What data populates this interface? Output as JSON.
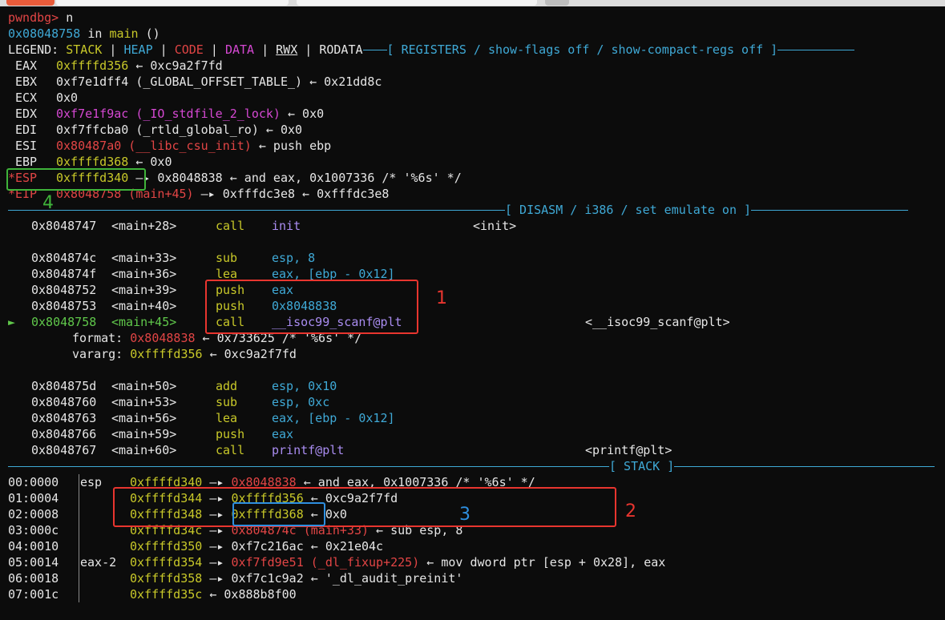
{
  "prompt": "pwndbg>",
  "command": "n",
  "location": {
    "addr": "0x08048758",
    "in": "in",
    "func": "main",
    "args": "()"
  },
  "legend": {
    "label": "LEGEND:",
    "stack": "STACK",
    "heap": "HEAP",
    "code": "CODE",
    "data": "DATA",
    "rwx": "RWX",
    "rodata": "RODATA"
  },
  "headers": {
    "registers": "[ REGISTERS / show-flags off / show-compact-regs off ]",
    "disasm": "[ DISASM / i386 / set emulate on ]",
    "stack": "[ STACK ]"
  },
  "registers": [
    {
      "name": "EAX",
      "star": "",
      "val": "0xffffd356",
      "rest": " ← 0xc9a2f7fd"
    },
    {
      "name": "EBX",
      "star": "",
      "val": "0xf7e1dff4 (_GLOBAL_OFFSET_TABLE_)",
      "rest": " ← 0x21dd8c"
    },
    {
      "name": "ECX",
      "star": "",
      "val": "0x0",
      "rest": ""
    },
    {
      "name": "EDX",
      "star": "",
      "val": "0xf7e1f9ac (_IO_stdfile_2_lock)",
      "rest": " ← 0x0"
    },
    {
      "name": "EDI",
      "star": "",
      "val": "0xf7ffcba0 (_rtld_global_ro)",
      "rest": " ← 0x0"
    },
    {
      "name": "ESI",
      "star": "",
      "val": "0x80487a0 (__libc_csu_init)",
      "rest": " ← push ebp"
    },
    {
      "name": "EBP",
      "star": "",
      "val": "0xffffd368",
      "rest": " ← 0x0"
    },
    {
      "name": "ESP",
      "star": "*",
      "val": "0xffffd340",
      "rest": " —▸ 0x8048838 ← and eax, 0x1007336 /* '%6s' */"
    },
    {
      "name": "EIP",
      "star": "*",
      "val": "0x8048758 (main+45)",
      "rest": " —▸ 0xfffdc3e8 ← 0xfffdc3e8"
    }
  ],
  "disasm": [
    {
      "marker": "",
      "addr": "0x8048747",
      "sym": "<main+28>",
      "op": "call",
      "args": "init",
      "target": "<init>"
    },
    {
      "marker": "",
      "addr": "",
      "sym": "",
      "op": "",
      "args": "",
      "target": ""
    },
    {
      "marker": "",
      "addr": "0x804874c",
      "sym": "<main+33>",
      "op": "sub",
      "args": "esp, 8",
      "target": ""
    },
    {
      "marker": "",
      "addr": "0x804874f",
      "sym": "<main+36>",
      "op": "lea",
      "args": "eax, [ebp - 0x12]",
      "target": ""
    },
    {
      "marker": "",
      "addr": "0x8048752",
      "sym": "<main+39>",
      "op": "push",
      "args": "eax",
      "target": ""
    },
    {
      "marker": "",
      "addr": "0x8048753",
      "sym": "<main+40>",
      "op": "push",
      "args": "0x8048838",
      "target": ""
    },
    {
      "marker": "►",
      "addr": "0x8048758",
      "sym": "<main+45>",
      "op": "call",
      "args": "__isoc99_scanf@plt",
      "target": "<__isoc99_scanf@plt>"
    }
  ],
  "call_args": [
    {
      "label": "format:",
      "val": "0x8048838",
      "rest": " ← 0x733625 /* '%6s' */"
    },
    {
      "label": "vararg:",
      "val": "0xffffd356",
      "rest": " ← 0xc9a2f7fd"
    }
  ],
  "disasm2": [
    {
      "addr": "0x804875d",
      "sym": "<main+50>",
      "op": "add",
      "args": "esp, 0x10",
      "target": ""
    },
    {
      "addr": "0x8048760",
      "sym": "<main+53>",
      "op": "sub",
      "args": "esp, 0xc",
      "target": ""
    },
    {
      "addr": "0x8048763",
      "sym": "<main+56>",
      "op": "lea",
      "args": "eax, [ebp - 0x12]",
      "target": ""
    },
    {
      "addr": "0x8048766",
      "sym": "<main+59>",
      "op": "push",
      "args": "eax",
      "target": ""
    },
    {
      "addr": "0x8048767",
      "sym": "<main+60>",
      "op": "call",
      "args": "printf@plt",
      "target": "<printf@plt>"
    }
  ],
  "stack": [
    {
      "idx": "00:0000",
      "reg": "esp",
      "addr": "0xffffd340",
      "arrow": " —▸ ",
      "ptr": "0x8048838",
      "rest": " ← and eax, 0x1007336 /* '%6s' */"
    },
    {
      "idx": "01:0004",
      "reg": "",
      "addr": "0xffffd344",
      "arrow": " —▸ ",
      "ptr": "0xffffd356",
      "rest": " ← 0xc9a2f7fd"
    },
    {
      "idx": "02:0008",
      "reg": "",
      "addr": "0xffffd348",
      "arrow": " —▸ ",
      "ptr": "0xffffd368",
      "rest": " ← 0x0"
    },
    {
      "idx": "03:000c",
      "reg": "",
      "addr": "0xffffd34c",
      "arrow": " —▸ ",
      "ptr": "0x804874c (main+33)",
      "rest": " ← sub esp, 8"
    },
    {
      "idx": "04:0010",
      "reg": "",
      "addr": "0xffffd350",
      "arrow": " —▸ ",
      "ptr": "0xf7c216ac",
      "rest": " ← 0x21e04c"
    },
    {
      "idx": "05:0014",
      "reg": "eax-2",
      "addr": "0xffffd354",
      "arrow": " —▸ ",
      "ptr": "0xf7fd9e51 (_dl_fixup+225)",
      "rest": " ← mov dword ptr [esp + 0x28], eax"
    },
    {
      "idx": "06:0018",
      "reg": "",
      "addr": "0xffffd358",
      "arrow": " —▸ ",
      "ptr": "0xf7c1c9a2",
      "rest": " ← '_dl_audit_preinit'"
    },
    {
      "idx": "07:001c",
      "reg": "",
      "addr": "0xffffd35c",
      "arrow": " ← ",
      "ptr": "0x888b8f00",
      "rest": ""
    }
  ],
  "annotations": {
    "a1": "1",
    "a2": "2",
    "a3": "3",
    "a4": "4"
  },
  "colors": {
    "red_box": "#e8352f",
    "green_box": "#3fb33a",
    "blue_box": "#2e8fe0"
  }
}
